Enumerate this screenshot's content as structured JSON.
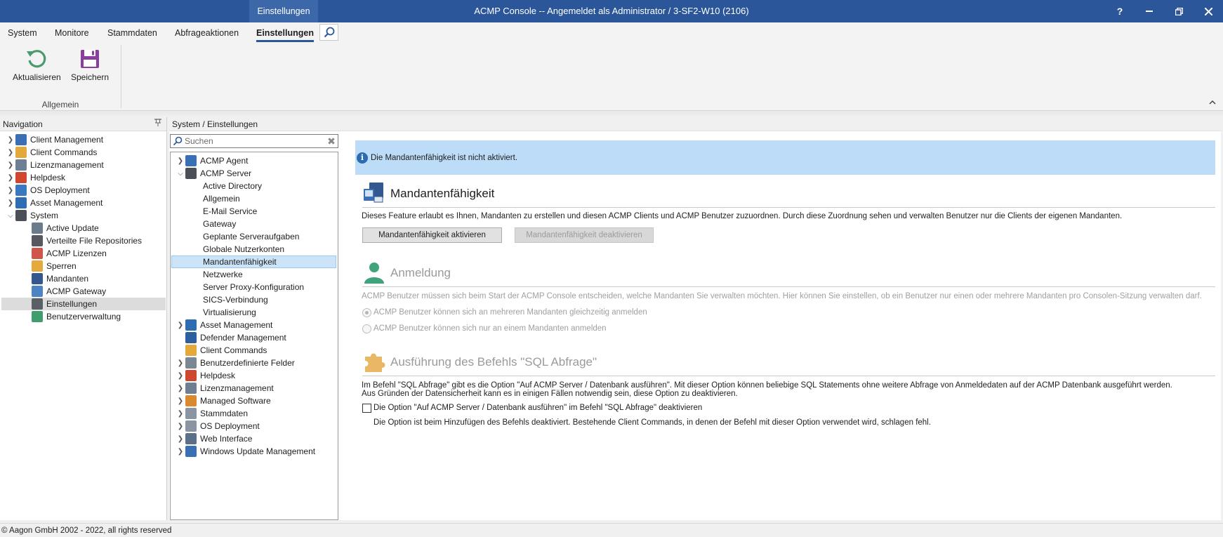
{
  "titlebar": {
    "context_tab": "Einstellungen",
    "title": "ACMP Console -- Angemeldet als Administrator / 3-SF2-W10 (2106)",
    "help": "?"
  },
  "ribbon": {
    "tabs": [
      "System",
      "Monitore",
      "Stammdaten",
      "Abfrageaktionen",
      "Einstellungen"
    ],
    "active_tab": "Einstellungen",
    "buttons": {
      "refresh": "Aktualisieren",
      "save": "Speichern"
    },
    "group_label": "Allgemein"
  },
  "navigation": {
    "header": "Navigation",
    "items": [
      {
        "label": "Client Management",
        "icon": "monitor-icon"
      },
      {
        "label": "Client Commands",
        "icon": "puzzle-icon"
      },
      {
        "label": "Lizenzmanagement",
        "icon": "license-icon"
      },
      {
        "label": "Helpdesk",
        "icon": "tag-icon"
      },
      {
        "label": "OS Deployment",
        "icon": "disk-icon"
      },
      {
        "label": "Asset Management",
        "icon": "stack-icon"
      },
      {
        "label": "System",
        "icon": "server-icon"
      },
      {
        "label": "Active Update",
        "icon": "update-icon"
      },
      {
        "label": "Verteilte File Repositories",
        "icon": "repository-icon"
      },
      {
        "label": "ACMP Lizenzen",
        "icon": "certificate-icon"
      },
      {
        "label": "Sperren",
        "icon": "lock-icon"
      },
      {
        "label": "Mandanten",
        "icon": "tenant-icon"
      },
      {
        "label": "ACMP Gateway",
        "icon": "gateway-icon"
      },
      {
        "label": "Einstellungen",
        "icon": "tools-icon"
      },
      {
        "label": "Benutzerverwaltung",
        "icon": "users-icon"
      }
    ],
    "selected": "Einstellungen"
  },
  "breadcrumb": "System / Einstellungen",
  "settings_search": {
    "placeholder": "Suchen"
  },
  "settings_tree": {
    "items": [
      {
        "label": "ACMP Agent"
      },
      {
        "label": "ACMP Server"
      },
      {
        "label": "Active Directory"
      },
      {
        "label": "Allgemein"
      },
      {
        "label": "E-Mail Service"
      },
      {
        "label": "Gateway"
      },
      {
        "label": "Geplante Serveraufgaben"
      },
      {
        "label": "Globale Nutzerkonten"
      },
      {
        "label": "Mandantenfähigkeit"
      },
      {
        "label": "Netzwerke"
      },
      {
        "label": "Server Proxy-Konfiguration"
      },
      {
        "label": "SICS-Verbindung"
      },
      {
        "label": "Virtualisierung"
      },
      {
        "label": "Asset Management"
      },
      {
        "label": "Defender Management"
      },
      {
        "label": "Client Commands"
      },
      {
        "label": "Benutzerdefinierte Felder"
      },
      {
        "label": "Helpdesk"
      },
      {
        "label": "Lizenzmanagement"
      },
      {
        "label": "Managed Software"
      },
      {
        "label": "Stammdaten"
      },
      {
        "label": "OS Deployment"
      },
      {
        "label": "Web Interface"
      },
      {
        "label": "Windows Update Management"
      }
    ],
    "selected": "Mandantenfähigkeit"
  },
  "info_bar": "Die Mandantenfähigkeit ist nicht aktiviert.",
  "section_multitenancy": {
    "title": "Mandantenfähigkeit",
    "description": "Dieses Feature erlaubt es Ihnen, Mandanten zu erstellen und diesen ACMP Clients und ACMP Benutzer zuzuordnen. Durch diese Zuordnung sehen und verwalten Benutzer nur die Clients der eigenen Mandanten.",
    "activate_button": "Mandantenfähigkeit aktivieren",
    "deactivate_button": "Mandantenfähigkeit deaktivieren"
  },
  "section_login": {
    "title": "Anmeldung",
    "description": "ACMP Benutzer müssen sich beim Start der ACMP Console entscheiden, welche Mandanten Sie verwalten möchten. Hier können Sie einstellen, ob ein Benutzer nur einen oder mehrere Mandanten pro Consolen-Sitzung verwalten darf.",
    "option_multiple": "ACMP Benutzer können sich an mehreren Mandanten gleichzeitig anmelden",
    "option_single": "ACMP Benutzer können sich nur an einem Mandanten anmelden",
    "selected_option": "option_multiple"
  },
  "section_sql": {
    "title": "Ausführung des Befehls \"SQL Abfrage\"",
    "description_1": "Im Befehl \"SQL Abfrage\" gibt es die Option \"Auf ACMP Server / Datenbank ausführen\". Mit dieser Option können beliebige SQL Statements ohne weitere Abfrage von Anmeldedaten auf der ACMP Datenbank ausgeführt werden.",
    "description_2": "Aus Gründen der Datensicherheit kann es in einigen Fällen notwendig sein, diese Option zu deaktivieren.",
    "checkbox_label": "Die Option \"Auf ACMP Server / Datenbank ausführen\" im Befehl \"SQL Abfrage\" deaktivieren",
    "checkbox_checked": false,
    "hint": "Die Option ist beim Hinzufügen des Befehls deaktiviert. Bestehende Client Commands, in denen der Befehl mit dieser Option verwendet wird, schlagen fehl."
  },
  "statusbar": "© Aagon GmbH 2002 - 2022, all rights reserved",
  "colors": {
    "titlebar": "#2b579a",
    "info_bar": "#bcdcf7",
    "tree_selection": "#cce4f7",
    "refresh_icon": "#4a9a6e",
    "save_icon": "#8a3f9c"
  }
}
